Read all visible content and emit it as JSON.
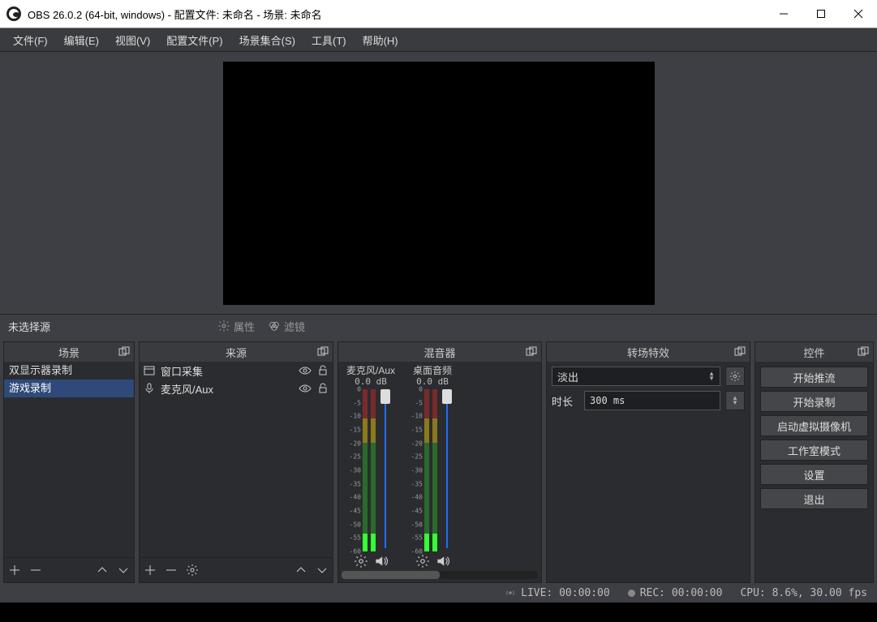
{
  "window": {
    "title": "OBS 26.0.2 (64-bit, windows) - 配置文件: 未命名 - 场景: 未命名"
  },
  "menu": {
    "file": "文件(F)",
    "edit": "编辑(E)",
    "view": "视图(V)",
    "profile": "配置文件(P)",
    "scene_collection": "场景集合(S)",
    "tools": "工具(T)",
    "help": "帮助(H)"
  },
  "midbar": {
    "no_source_selected": "未选择源",
    "properties": "属性",
    "filters": "滤镜"
  },
  "docks": {
    "scenes": {
      "title": "场景",
      "items": [
        "双显示器录制",
        "游戏录制"
      ],
      "selected_index": 1
    },
    "sources": {
      "title": "来源",
      "items": [
        {
          "icon": "window-capture-icon",
          "label": "窗口采集"
        },
        {
          "icon": "microphone-icon",
          "label": "麦克风/Aux"
        }
      ]
    },
    "mixer": {
      "title": "混音器",
      "channels": [
        {
          "name": "麦克风/Aux",
          "db": "0.0 dB"
        },
        {
          "name": "桌面音频",
          "db": "0.0 dB"
        }
      ],
      "scale_labels": [
        "0",
        "-5",
        "-10",
        "-15",
        "-20",
        "-25",
        "-30",
        "-35",
        "-40",
        "-45",
        "-50",
        "-55",
        "-60"
      ]
    },
    "transitions": {
      "title": "转场特效",
      "selected": "淡出",
      "duration_label": "时长",
      "duration_value": "300 ms"
    },
    "controls": {
      "title": "控件",
      "buttons": {
        "start_streaming": "开始推流",
        "start_recording": "开始录制",
        "start_virtualcam": "启动虚拟摄像机",
        "studio_mode": "工作室模式",
        "settings": "设置",
        "exit": "退出"
      }
    }
  },
  "status": {
    "live": "LIVE: 00:00:00",
    "rec": "REC: 00:00:00",
    "cpu": "CPU: 8.6%, 30.00 fps"
  }
}
